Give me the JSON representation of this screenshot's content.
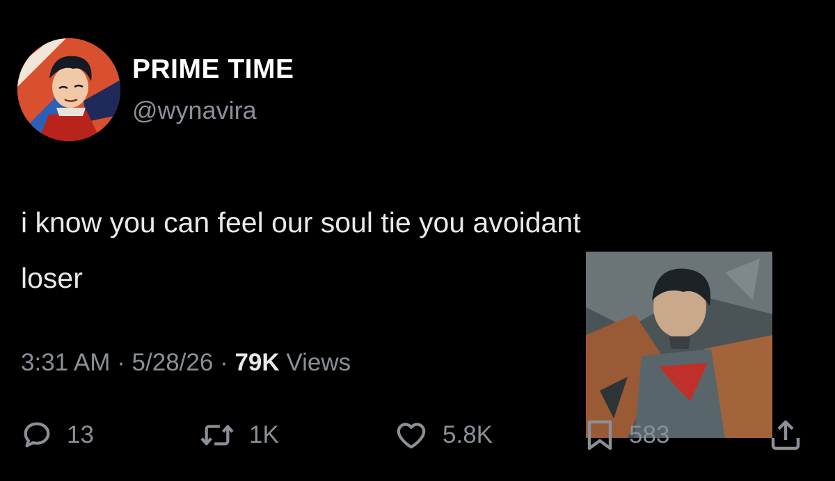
{
  "author": {
    "display_name": "PRIME TIME",
    "handle": "@wynavira",
    "avatar_icon": "comic-character-avatar"
  },
  "tweet": {
    "text": "i know you can feel our soul tie you avoidant\nloser",
    "time": "3:31 AM",
    "date": "5/28/26",
    "views_count": "79K",
    "views_label": "Views"
  },
  "media": {
    "icon": "comic-art-image"
  },
  "actions": {
    "reply": {
      "icon": "reply-bubble-icon",
      "count": "13"
    },
    "repost": {
      "icon": "repost-arrows-icon",
      "count": "1K"
    },
    "like": {
      "icon": "heart-icon",
      "count": "5.8K"
    },
    "bookmark": {
      "icon": "bookmark-icon",
      "count": "583"
    },
    "share": {
      "icon": "share-upload-icon"
    }
  },
  "colors": {
    "background": "#000000",
    "text_primary": "#e7e9ea",
    "text_secondary": "#8b9097",
    "avatar_accent": "#d9502f"
  }
}
